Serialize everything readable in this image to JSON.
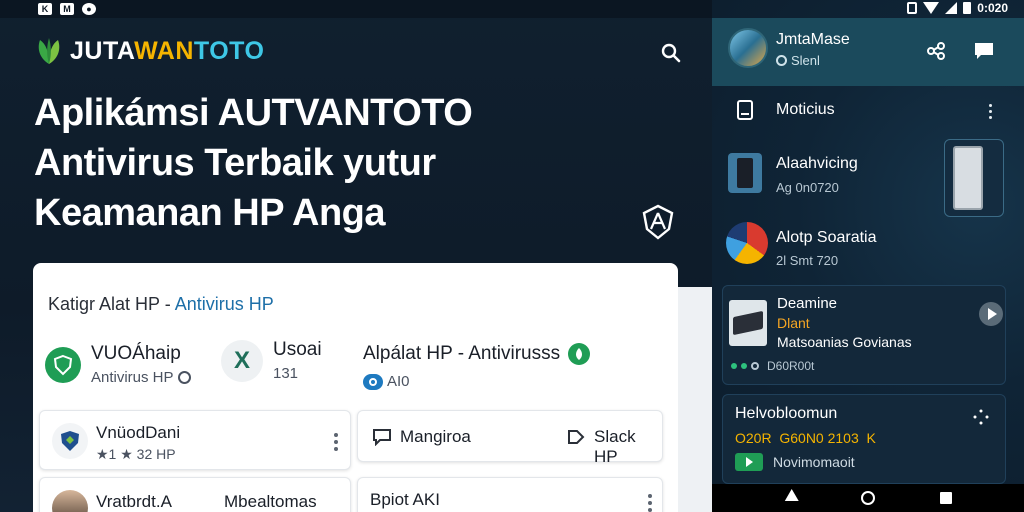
{
  "status_bar_left": {
    "icons": [
      "k-icon",
      "mail-icon",
      "location-icon"
    ]
  },
  "status_bar_right": {
    "time": "0:020"
  },
  "site": {
    "logo_part1": "JUTA",
    "logo_part2": "WAN",
    "logo_part3": "TOTO",
    "hero_title": "Aplikámsi AUTVANTOTO Antivirus Terbaik yutur Keamanan HP Anga"
  },
  "card": {
    "heading_prefix": "Katigr Alat HP - ",
    "heading_accent": "Antivirus HP",
    "apps": [
      {
        "title": "VUOÁhaip",
        "sub": "Antivirus HP"
      },
      {
        "title": "Usoai",
        "sub": "131"
      },
      {
        "title": "Alpálat HP - Antivirusss",
        "sub": "AI0"
      }
    ],
    "row2": [
      {
        "title": "VnüodDani",
        "sub": "★1 ★ 32 HP"
      },
      {
        "label": "Mangiroa",
        "action": "Slack HP"
      }
    ],
    "row3": [
      {
        "title": "Vratbrdt.A",
        "second": "Mbealtomas"
      },
      {
        "title": "Bpiot AKI"
      }
    ]
  },
  "phone": {
    "user_name": "JmtaMase",
    "user_sub": "Slenl",
    "rows": [
      {
        "label": "Moticius"
      },
      {
        "label": "Alaahvicing",
        "sub": "Ag 0n0720"
      },
      {
        "label": "Alotp Soaratia",
        "sub": "2l Smt 720"
      }
    ],
    "card1": {
      "title": "Deamine",
      "line2": "Dlant",
      "line3": "Matsoanias Govianas",
      "foot": "D60R00t"
    },
    "card2": {
      "title": "Helvobloomun",
      "line2": "O20R  G60N0 2103  K",
      "line3": "Novimomaoit"
    }
  },
  "colors": {
    "brand_yellow": "#f5b400",
    "brand_cyan": "#3ec7e6",
    "accent_blue": "#1d6fa8",
    "green": "#1f9d55",
    "header_teal": "#1b4a5c"
  }
}
